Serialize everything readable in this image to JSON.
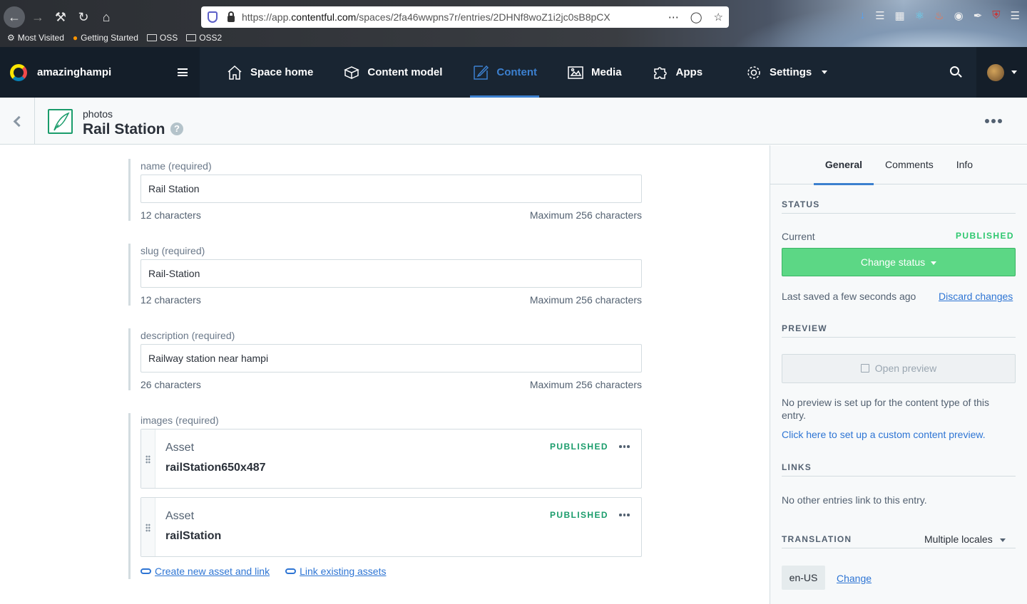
{
  "browser": {
    "url_prefix": "https://app.",
    "url_domain": "contentful.com",
    "url_path": "/spaces/2fa46wwpns7r/entries/2DHNf8woZ1i2jc0sB8pCX",
    "bookmarks": [
      "Most Visited",
      "Getting Started",
      "OSS",
      "OSS2"
    ]
  },
  "topnav": {
    "space_name": "amazinghampi",
    "items": [
      {
        "label": "Space home",
        "icon": "house-icon"
      },
      {
        "label": "Content model",
        "icon": "cubes-icon"
      },
      {
        "label": "Content",
        "icon": "pen-icon",
        "active": true
      },
      {
        "label": "Media",
        "icon": "image-icon"
      },
      {
        "label": "Apps",
        "icon": "puzzle-icon"
      },
      {
        "label": "Settings",
        "icon": "gear-icon"
      }
    ]
  },
  "entry": {
    "content_type": "photos",
    "title": "Rail Station",
    "help": "?"
  },
  "fields": [
    {
      "label": "name (required)",
      "value": "Rail Station",
      "count": "12 characters",
      "max": "Maximum 256 characters"
    },
    {
      "label": "slug (required)",
      "value": "Rail-Station",
      "count": "12 characters",
      "max": "Maximum 256 characters"
    },
    {
      "label": "description (required)",
      "value": "Railway station near hampi",
      "count": "26 characters",
      "max": "Maximum 256 characters"
    }
  ],
  "images": {
    "label": "images (required)",
    "assets": [
      {
        "type": "Asset",
        "name": "railStation650x487",
        "status": "PUBLISHED"
      },
      {
        "type": "Asset",
        "name": "railStation",
        "status": "PUBLISHED"
      }
    ],
    "create_link": "Create new asset and link",
    "existing_link": "Link existing assets"
  },
  "sidebar": {
    "tabs": [
      "General",
      "Comments",
      "Info"
    ],
    "status_heading": "STATUS",
    "current_label": "Current",
    "current_status": "PUBLISHED",
    "change_status": "Change status",
    "last_saved": "Last saved a few seconds ago",
    "discard": "Discard changes",
    "preview_heading": "PREVIEW",
    "open_preview": "Open preview",
    "preview_note": "No preview is set up for the content type of this entry.",
    "preview_link": "Click here to set up a custom content preview.",
    "links_heading": "LINKS",
    "links_note": "No other entries link to this entry.",
    "translation_heading": "TRANSLATION",
    "locale_select": "Multiple locales",
    "locale": "en-US",
    "locale_change": "Change"
  },
  "colors": {
    "nav_bg": "#192532",
    "accent": "#3c80cf",
    "published": "#1a9c6b",
    "change_status_bg": "#5cd785",
    "link": "#2e75d4"
  }
}
